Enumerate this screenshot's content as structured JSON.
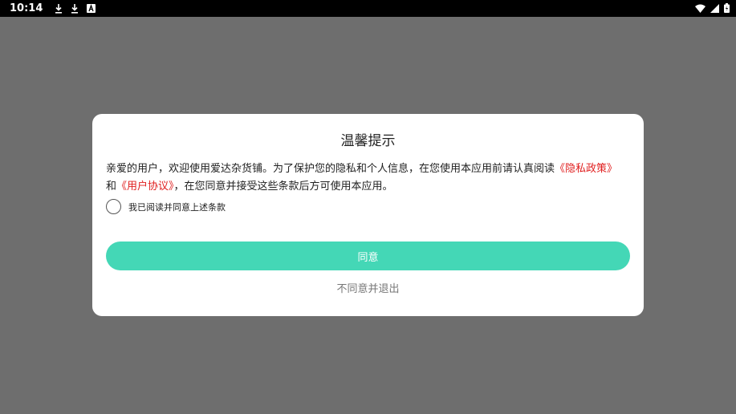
{
  "status_bar": {
    "time": "10:14",
    "left_icons": [
      "download-icon",
      "download-icon",
      "a-box-icon"
    ],
    "right_icons": [
      "wifi-icon",
      "cell-signal-icon",
      "battery-icon"
    ]
  },
  "dialog": {
    "title": "温馨提示",
    "body_prefix": "亲爱的用户，欢迎使用爱达杂货铺。为了保护您的隐私和个人信息，在您使用本应用前请认真阅读",
    "privacy_link": "《隐私政策》",
    "conjunction": "和",
    "agreement_link": "《用户协议》",
    "body_suffix": "，在您同意并接受这些条款后方可使用本应用。",
    "consent_label": "我已阅读并同意上述条款",
    "agree_label": "同意",
    "disagree_label": "不同意并退出"
  },
  "colors": {
    "accent": "#44d7b6",
    "link": "#e02020",
    "overlay": "#6e6e6e"
  }
}
